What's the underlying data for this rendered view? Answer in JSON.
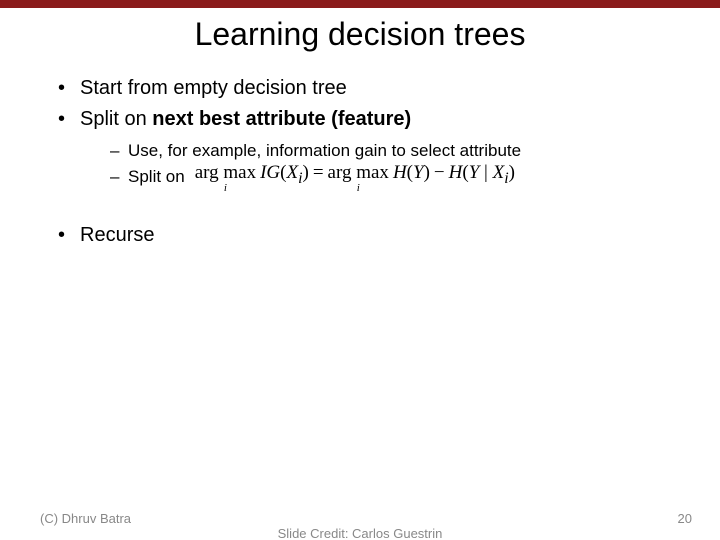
{
  "title": "Learning decision trees",
  "bullets": {
    "b1": "Start from empty decision tree",
    "b2_pre": "Split on ",
    "b2_bold": "next best attribute (feature)",
    "b2a": "Use, for example, information gain to select attribute",
    "b2b_pre": "Split on",
    "b3": "Recurse"
  },
  "formula": {
    "argmax1": "arg max",
    "sub1": "i",
    "ig": "IG",
    "xi_open": "(",
    "X": "X",
    "i": "i",
    "close": ")",
    "eq": " = ",
    "argmax2": "arg max",
    "sub2": "i",
    "H": "H",
    "Y": "Y",
    "minus": " − ",
    "bar": " | "
  },
  "footer": {
    "left": "(C) Dhruv Batra",
    "mid": "Slide Credit: Carlos Guestrin",
    "right": "20"
  }
}
